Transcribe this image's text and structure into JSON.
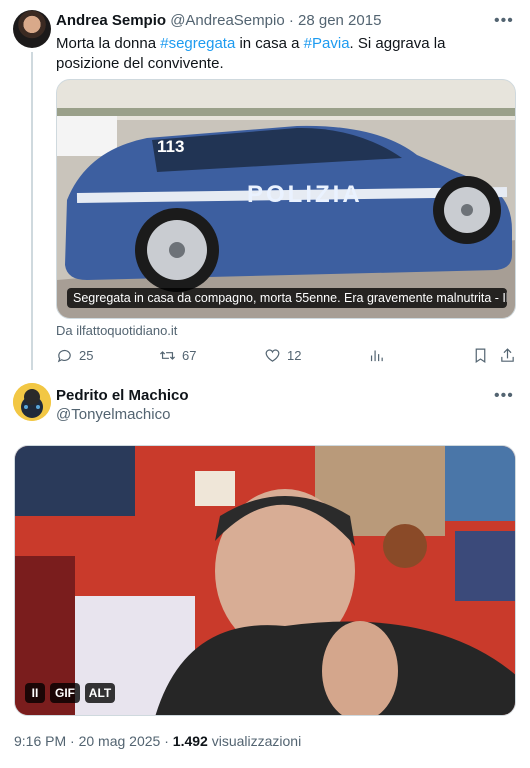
{
  "tweet1": {
    "author_name": "Andrea Sempio",
    "author_handle": "@AndreaSempio",
    "separator": "·",
    "date": "28 gen 2015",
    "text_parts": {
      "a": "Morta la donna ",
      "h1": "#segregata",
      "b": " in casa a ",
      "h2": "#Pavia",
      "c": ". Si aggrava la posizione del convivente."
    },
    "card": {
      "caption": "Segregata in casa da compagno, morta 55enne. Era gravemente malnutrita - Il ...",
      "domain": "Da ilfattoquotidiano.it",
      "image_text_number": "113",
      "image_text_word": "POLIZIA"
    },
    "actions": {
      "replies": "25",
      "retweets": "67",
      "likes": "12"
    }
  },
  "tweet2": {
    "author_name": "Pedrito el Machico",
    "author_handle": "@Tonyelmachico",
    "video": {
      "pause_label": "II",
      "gif_label": "GIF",
      "alt_label": "ALT"
    },
    "time": "9:16 PM",
    "separator": "·",
    "date": "20 mag 2025",
    "separator2": "·",
    "views_count": "1.492",
    "views_label": "visualizzazioni"
  },
  "icons": {
    "more": "more-icon",
    "reply": "reply-icon",
    "retweet": "retweet-icon",
    "like": "heart-icon",
    "analytics": "analytics-icon",
    "bookmark": "bookmark-icon",
    "share": "share-icon"
  },
  "colors": {
    "link": "#1d9bf0",
    "muted": "#536471",
    "text": "#0f1419"
  }
}
